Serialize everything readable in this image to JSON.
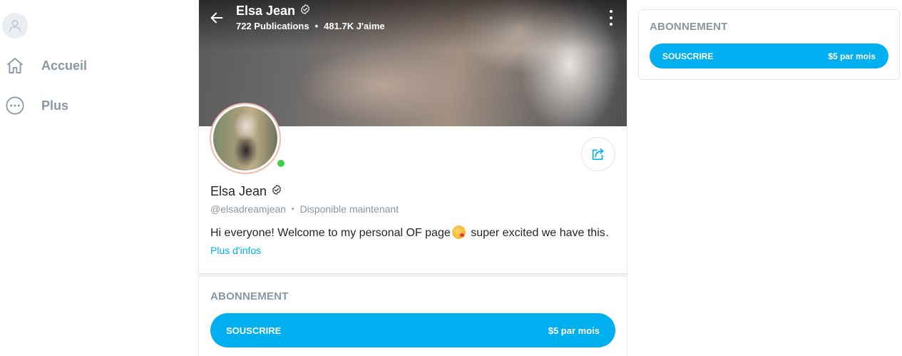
{
  "sidebar": {
    "items": [
      {
        "label": "Accueil",
        "icon": "home-icon"
      },
      {
        "label": "Plus",
        "icon": "more-circle-icon"
      }
    ]
  },
  "profile": {
    "name": "Elsa Jean",
    "publications": "722 Publications",
    "likes": "481.7K J'aime",
    "handle": "@elsadreamjean",
    "status": "Disponible maintenant",
    "bio_before": "Hi everyone! Welcome to my personal OF page",
    "bio_after": " super excited we have this…",
    "more_info": "Plus d'infos",
    "online": true
  },
  "subscription": {
    "title": "ABONNEMENT",
    "button_label": "SOUSCRIRE",
    "price": "$5 par mois"
  },
  "colors": {
    "accent": "#00aff0",
    "muted": "#8a96a3",
    "online": "#3ccf4e"
  }
}
